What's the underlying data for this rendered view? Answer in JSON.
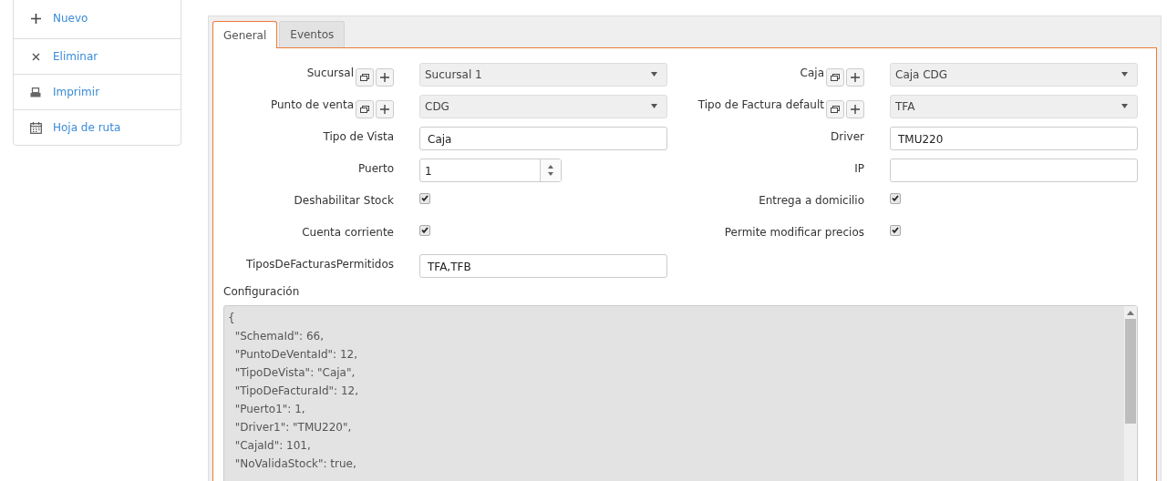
{
  "sidebar": {
    "items": [
      {
        "label": "Nuevo"
      },
      {
        "label": "Eliminar"
      },
      {
        "label": "Imprimir"
      },
      {
        "label": "Hoja de ruta"
      }
    ]
  },
  "tabs": [
    {
      "label": "General",
      "selected": true
    },
    {
      "label": "Eventos",
      "selected": false
    }
  ],
  "form": {
    "rows": [
      {
        "left": {
          "kind": "select",
          "label": "Sucursal",
          "value": "Sucursal 1"
        },
        "right": {
          "kind": "select",
          "label": "Caja",
          "value": "Caja CDG"
        }
      },
      {
        "left": {
          "kind": "select",
          "label": "Punto de venta",
          "value": "CDG"
        },
        "right": {
          "kind": "select",
          "label": "Tipo de Factura default",
          "value": "TFA"
        }
      },
      {
        "left": {
          "kind": "text",
          "label": "Tipo de Vista",
          "value": "Caja"
        },
        "right": {
          "kind": "text",
          "label": "Driver",
          "value": "TMU220"
        }
      },
      {
        "left": {
          "kind": "number",
          "label": "Puerto",
          "value": "1"
        },
        "right": {
          "kind": "text",
          "label": "IP"
        }
      },
      {
        "left": {
          "kind": "checkbox",
          "label": "Deshabilitar Stock",
          "checked": true
        },
        "right": {
          "kind": "checkbox",
          "label": "Entrega a domicilio",
          "checked": true
        }
      },
      {
        "left": {
          "kind": "checkbox",
          "label": "Cuenta corriente",
          "checked": true
        },
        "right": {
          "kind": "checkbox",
          "label": "Permite modificar precios",
          "checked": true
        }
      },
      {
        "left": {
          "kind": "text",
          "label": "TiposDeFacturasPermitidos",
          "value": "TFA,TFB"
        }
      }
    ]
  },
  "config": {
    "label": "Configuración",
    "lines": [
      "{",
      "  \"SchemaId\": 66,",
      "  \"PuntoDeVentaId\": 12,",
      "  \"TipoDeVista\": \"Caja\",",
      "  \"TipoDeFacturaId\": 12,",
      "  \"Puerto1\": 1,",
      "  \"Driver1\": \"TMU220\",",
      "  \"CajaId\": 101,",
      "  \"NoValidaStock\": true,"
    ]
  }
}
